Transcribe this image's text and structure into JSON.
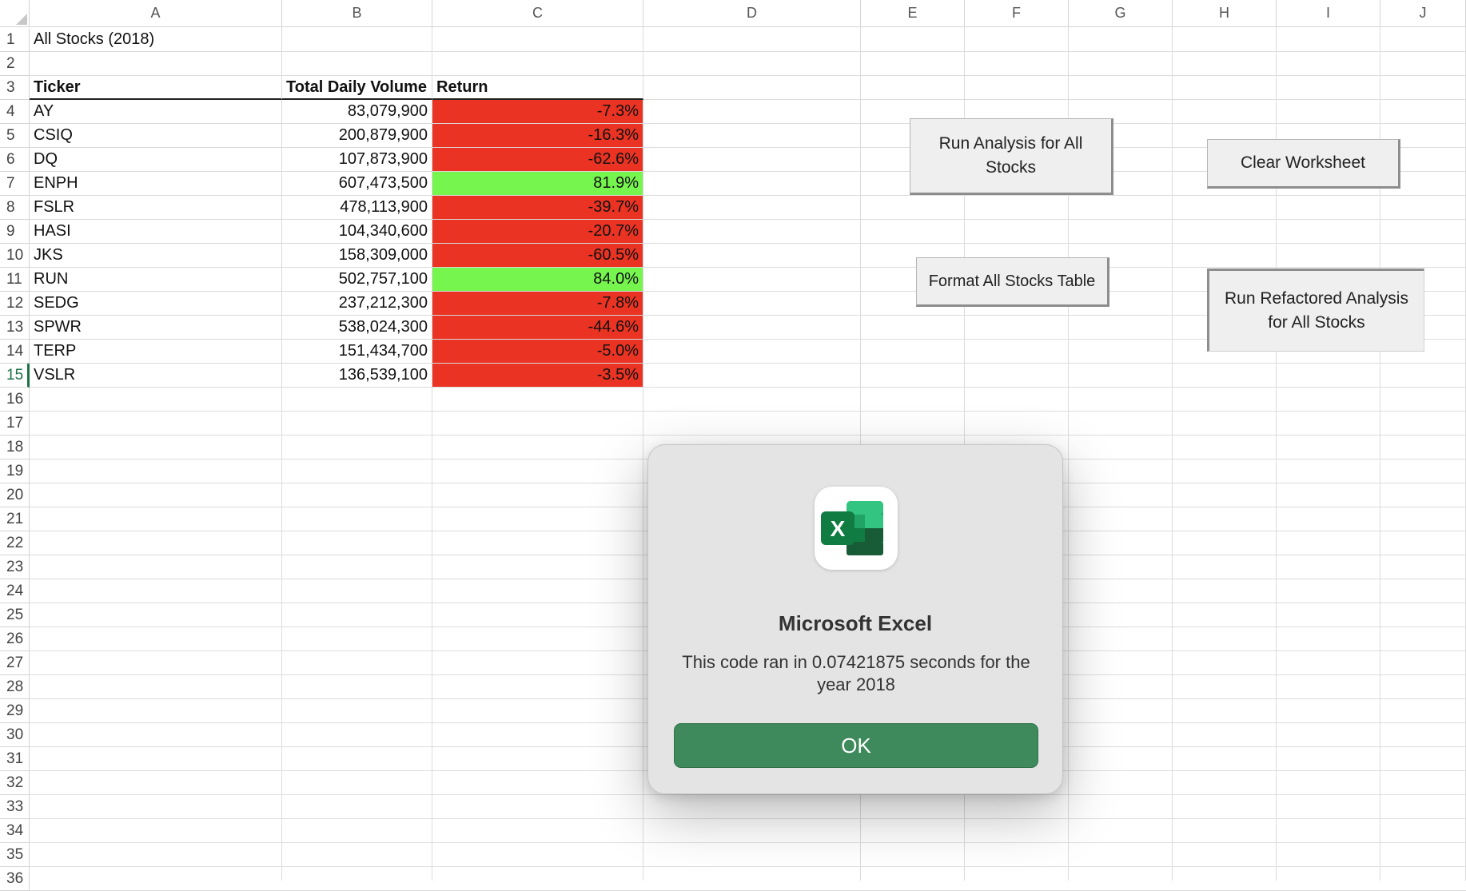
{
  "sheet": {
    "columns": [
      "A",
      "B",
      "C",
      "D",
      "E",
      "F",
      "G",
      "H",
      "I",
      "J"
    ],
    "title": "All Stocks (2018)",
    "headers": {
      "ticker": "Ticker",
      "volume": "Total Daily Volume",
      "return": "Return"
    },
    "rows": [
      {
        "ticker": "AY",
        "volume": "83,079,900",
        "return": "-7.3%",
        "positive": false
      },
      {
        "ticker": "CSIQ",
        "volume": "200,879,900",
        "return": "-16.3%",
        "positive": false
      },
      {
        "ticker": "DQ",
        "volume": "107,873,900",
        "return": "-62.6%",
        "positive": false
      },
      {
        "ticker": "ENPH",
        "volume": "607,473,500",
        "return": "81.9%",
        "positive": true
      },
      {
        "ticker": "FSLR",
        "volume": "478,113,900",
        "return": "-39.7%",
        "positive": false
      },
      {
        "ticker": "HASI",
        "volume": "104,340,600",
        "return": "-20.7%",
        "positive": false
      },
      {
        "ticker": "JKS",
        "volume": "158,309,000",
        "return": "-60.5%",
        "positive": false
      },
      {
        "ticker": "RUN",
        "volume": "502,757,100",
        "return": "84.0%",
        "positive": true
      },
      {
        "ticker": "SEDG",
        "volume": "237,212,300",
        "return": "-7.8%",
        "positive": false
      },
      {
        "ticker": "SPWR",
        "volume": "538,024,300",
        "return": "-44.6%",
        "positive": false
      },
      {
        "ticker": "TERP",
        "volume": "151,434,700",
        "return": "-5.0%",
        "positive": false
      },
      {
        "ticker": "VSLR",
        "volume": "136,539,100",
        "return": "-3.5%",
        "positive": false
      }
    ],
    "selected_row": "15",
    "row_numbers": [
      "1",
      "2",
      "3",
      "4",
      "5",
      "6",
      "7",
      "8",
      "9",
      "10",
      "11",
      "12",
      "13",
      "14",
      "15",
      "16",
      "17",
      "18",
      "19",
      "20",
      "21",
      "22",
      "23",
      "24",
      "25",
      "26",
      "27",
      "28",
      "29",
      "30",
      "31",
      "32",
      "33",
      "34",
      "35",
      "36"
    ]
  },
  "buttons": {
    "run_analysis": "Run Analysis for All Stocks",
    "clear_worksheet": "Clear Worksheet",
    "format_table": "Format All Stocks Table",
    "run_refactored": "Run Refactored Analysis for All Stocks"
  },
  "dialog": {
    "app_icon": "excel-app-icon",
    "icon_letter": "X",
    "title": "Microsoft Excel",
    "message": "This code ran in 0.07421875 seconds for the year 2018",
    "ok_label": "OK"
  },
  "colors": {
    "positive": "#76f54e",
    "negative": "#ea3323",
    "ok_button": "#3f8a5c",
    "excel_green": "#1e7145"
  }
}
